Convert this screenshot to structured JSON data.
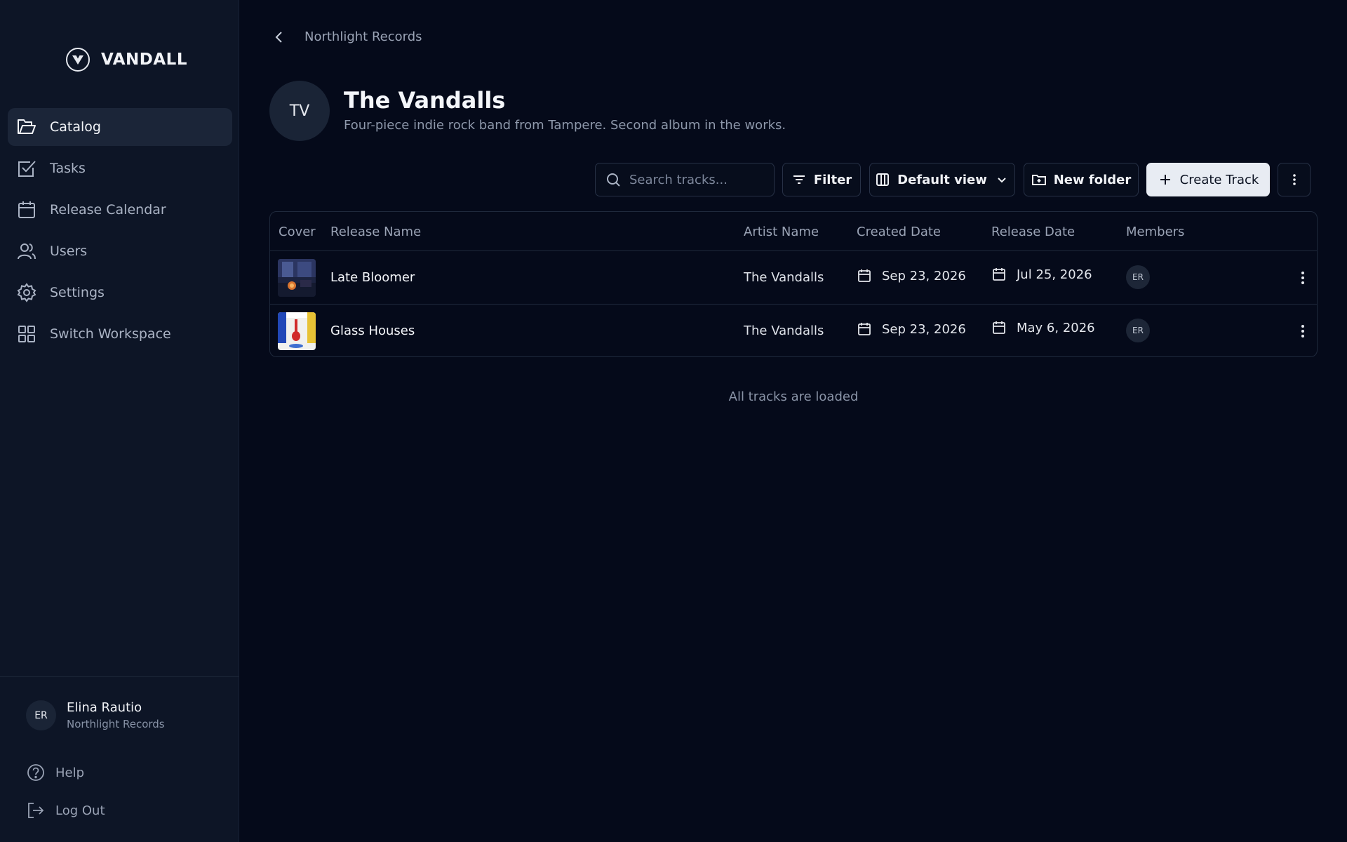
{
  "brand": {
    "name": "VANDALL",
    "icon": "vandall-logo-icon"
  },
  "sidebar": {
    "items": [
      {
        "label": "Catalog",
        "icon": "folder-open-icon",
        "active": true
      },
      {
        "label": "Tasks",
        "icon": "checkbox-icon",
        "active": false
      },
      {
        "label": "Release Calendar",
        "icon": "calendar-icon",
        "active": false
      },
      {
        "label": "Users",
        "icon": "users-icon",
        "active": false
      },
      {
        "label": "Settings",
        "icon": "gear-icon",
        "active": false
      },
      {
        "label": "Switch Workspace",
        "icon": "grid-icon",
        "active": false
      }
    ],
    "user": {
      "initials": "ER",
      "name": "Elina Rautio",
      "org": "Northlight Records"
    },
    "help_label": "Help",
    "logout_label": "Log Out"
  },
  "breadcrumb": {
    "label": "Northlight Records"
  },
  "artist": {
    "initials": "TV",
    "name": "The Vandalls",
    "description": "Four-piece indie rock band from Tampere. Second album in the works."
  },
  "toolbar": {
    "search_placeholder": "Search tracks...",
    "filter_label": "Filter",
    "view_label": "Default view",
    "new_folder_label": "New folder",
    "create_label": "Create Track"
  },
  "table": {
    "columns": [
      "Cover",
      "Release Name",
      "Artist Name",
      "Created Date",
      "Release Date",
      "Members"
    ],
    "rows": [
      {
        "release_name": "Late Bloomer",
        "artist": "The Vandalls",
        "created": "Sep 23, 2026",
        "release_date": "Jul 25, 2026",
        "members": "ER"
      },
      {
        "release_name": "Glass Houses",
        "artist": "The Vandalls",
        "created": "Sep 23, 2026",
        "release_date": "May 6, 2026",
        "members": "ER"
      }
    ]
  },
  "footer_note": "All tracks are loaded",
  "colors": {
    "background": "#050a1a",
    "sidebar": "#0d1526",
    "primary_button": "#e8ecf3"
  }
}
